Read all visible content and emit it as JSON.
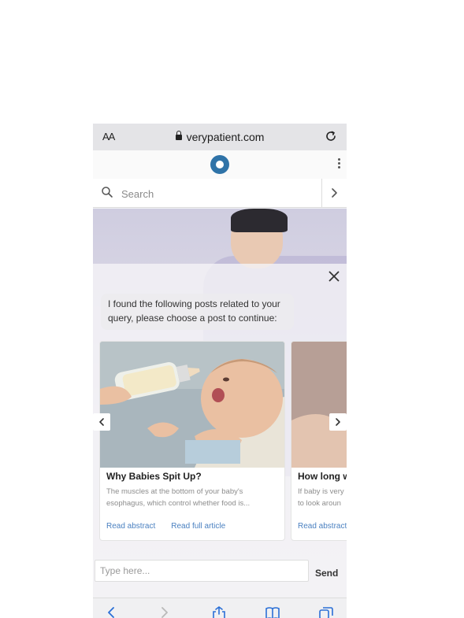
{
  "browser": {
    "text_size_label": "AA",
    "url": "verypatient.com"
  },
  "search": {
    "placeholder": "Search"
  },
  "chat": {
    "message": "I found the following posts related to your query, please choose a post to continue:",
    "input_placeholder": "Type here...",
    "send_label": "Send"
  },
  "cards": [
    {
      "title": "Why Babies Spit Up?",
      "excerpt": "The muscles at the bottom of your baby's esophagus, which control whether food is...",
      "read_abstract": "Read abstract",
      "read_full": "Read full article"
    },
    {
      "title": "How long w",
      "excerpt": "If baby is very to look aroun",
      "read_abstract": "Read abstract"
    }
  ],
  "colors": {
    "accent": "#2f73a8",
    "link": "#4a80c0"
  },
  "icons": [
    "lock-icon",
    "reload-icon",
    "site-logo-icon",
    "more-icon",
    "search-icon",
    "chevron-right-icon",
    "close-icon",
    "chevron-left-icon",
    "back-icon",
    "forward-icon",
    "share-icon",
    "bookmarks-icon",
    "tabs-icon"
  ]
}
